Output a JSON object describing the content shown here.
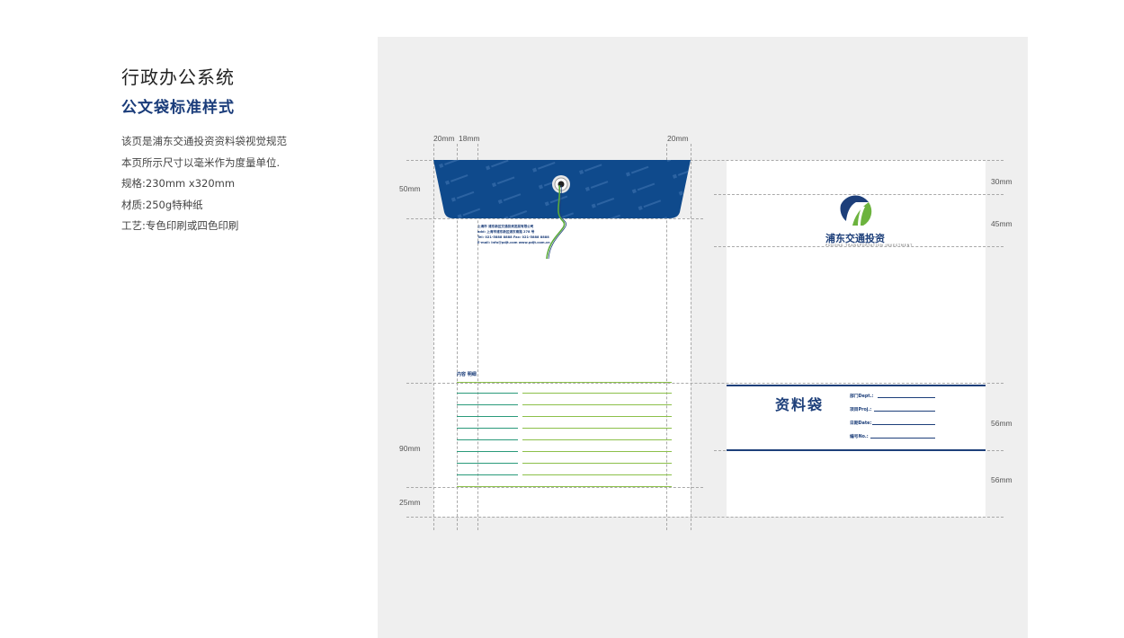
{
  "info": {
    "title": "行政办公系统",
    "subtitle": "公文袋标准样式",
    "lines": [
      "该页是浦东交通投资资料袋视觉规范",
      "本页所示尺寸以毫米作为度量单位.",
      "规格:230mm x320mm",
      "材质:250g特种纸",
      "工艺:专色印刷或四色印刷"
    ]
  },
  "dimensions": {
    "top_20mm_left": "20mm",
    "top_18mm": "18mm",
    "top_20mm_right": "20mm",
    "left_50mm": "50mm",
    "left_90mm": "90mm",
    "left_25mm": "25mm",
    "right_30mm": "30mm",
    "right_45mm": "45mm",
    "right_56mm_a": "56mm",
    "right_56mm_b": "56mm"
  },
  "back": {
    "address_lines": [
      "上海市 浦东新区交通投资发展有限公司",
      "add: 上海市浦东新区浦东南路 278 号",
      "Tel: 021-5888 8888   Fax: 021-5888 8888",
      "E-mail: info@pdjt.com   www.pdjt.com.cn"
    ],
    "content_label": "内容 明细"
  },
  "front": {
    "logo_cn": "浦东交通投资",
    "logo_en": "PUDONG TRANSPORTATION INVESTMENT",
    "doc_title": "资料袋",
    "fields": [
      "部门Dept.:",
      "项目Proj.:",
      "日期Date:",
      "编号No.:"
    ]
  },
  "colors": {
    "brand_blue": "#1d3f7a",
    "flap_blue": "#0f4a8c",
    "teal_line": "#2a9a7a",
    "green_line": "#8cc04a",
    "panel_bg": "#efefef"
  }
}
